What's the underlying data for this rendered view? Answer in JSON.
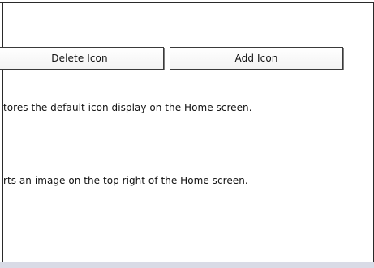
{
  "buttons": {
    "delete_icon": "Delete Icon",
    "add_icon": "Add Icon"
  },
  "descriptions": [
    "tores the default icon display on the Home screen.",
    "rts an image on the top right of the Home screen."
  ]
}
